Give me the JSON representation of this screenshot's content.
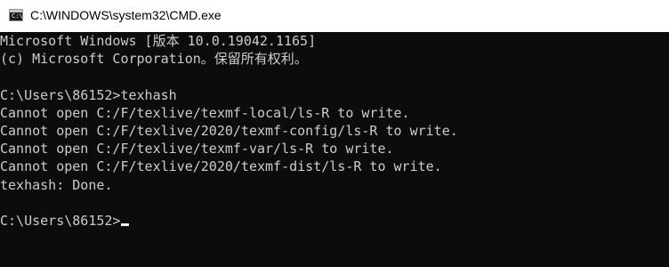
{
  "window": {
    "title": "C:\\WINDOWS\\system32\\CMD.exe",
    "icon": "cmd-app-icon",
    "icon_glyph": "C:\\"
  },
  "colors": {
    "console_background": "#0c0c0c",
    "console_text": "#cccccc",
    "titlebar_background": "#ffffff"
  },
  "console": {
    "lines": [
      "Microsoft Windows [版本 10.0.19042.1165]",
      "(c) Microsoft Corporation。保留所有权利。",
      "",
      "C:\\Users\\86152>texhash",
      "Cannot open C:/F/texlive/texmf-local/ls-R to write.",
      "Cannot open C:/F/texlive/2020/texmf-config/ls-R to write.",
      "Cannot open C:/F/texlive/texmf-var/ls-R to write.",
      "Cannot open C:/F/texlive/2020/texmf-dist/ls-R to write.",
      "texhash: Done.",
      "",
      "C:\\Users\\86152>"
    ]
  }
}
